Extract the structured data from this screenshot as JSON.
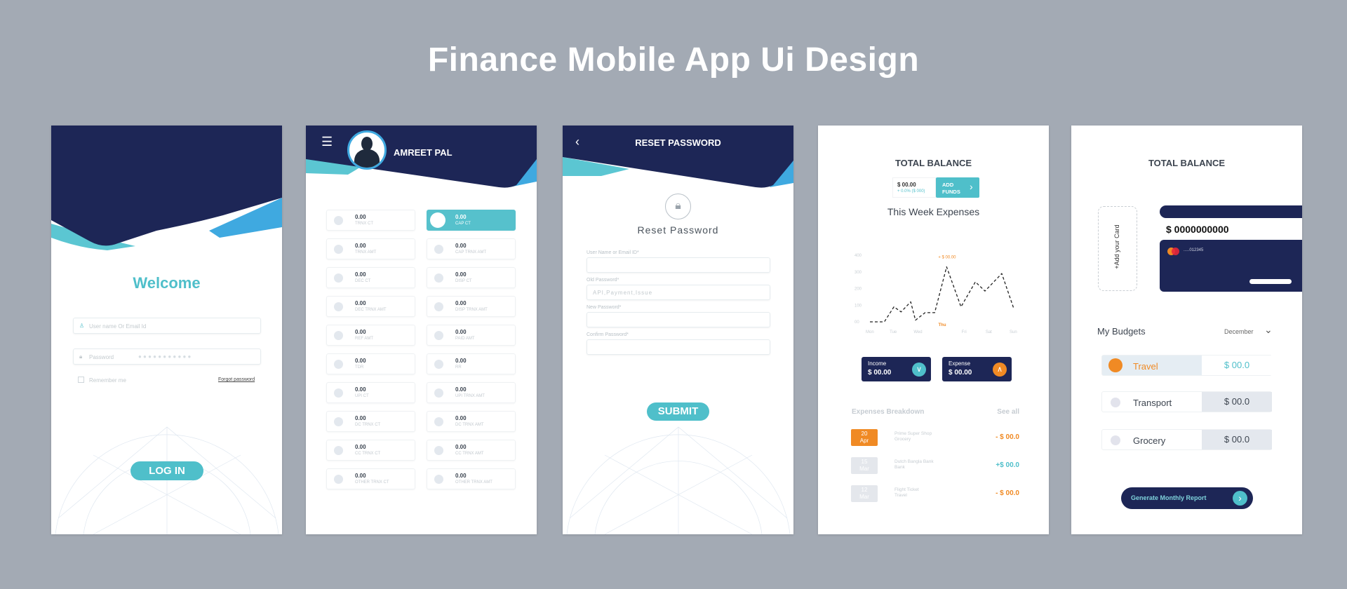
{
  "page_title": "Finance Mobile App Ui Design",
  "colors": {
    "navy": "#1d2656",
    "teal": "#4fbfca",
    "orange": "#f08a24",
    "background": "#a3aab4"
  },
  "login": {
    "welcome": "Welcome",
    "username_placeholder": "User name Or Email Id",
    "password_label": "Password",
    "password_mask": "● ● ● ● ● ● ● ● ● ● ●",
    "remember": "Remember me",
    "forgot": "Forgot password",
    "login_button": "LOG IN"
  },
  "dashboard": {
    "user_name": "AMREET PAL",
    "menu_icon": "hamburger-icon",
    "tiles": [
      {
        "value": "0.00",
        "label": "TRNX CT"
      },
      {
        "value": "0.00",
        "label": "CAP CT",
        "active": true
      },
      {
        "value": "0.00",
        "label": "TRNX AMT"
      },
      {
        "value": "0.00",
        "label": "CAP TRNX AMT"
      },
      {
        "value": "0.00",
        "label": "DEC CT"
      },
      {
        "value": "0.00",
        "label": "DISP CT"
      },
      {
        "value": "0.00",
        "label": "DEC TRNX AMT"
      },
      {
        "value": "0.00",
        "label": "DISP TRNX AMT"
      },
      {
        "value": "0.00",
        "label": "REF AMT"
      },
      {
        "value": "0.00",
        "label": "PAID AMT"
      },
      {
        "value": "0.00",
        "label": "TDR"
      },
      {
        "value": "0.00",
        "label": "RR"
      },
      {
        "value": "0.00",
        "label": "UPI CT"
      },
      {
        "value": "0.00",
        "label": "UPI TRNX AMT"
      },
      {
        "value": "0.00",
        "label": "DC TRNX CT"
      },
      {
        "value": "0.00",
        "label": "DC TRNX AMT"
      },
      {
        "value": "0.00",
        "label": "CC TRNX CT"
      },
      {
        "value": "0.00",
        "label": "CC TRNX AMT"
      },
      {
        "value": "0.00",
        "label": "OTHER TRNX CT"
      },
      {
        "value": "0.00",
        "label": "OTHER TRNX AMT"
      }
    ]
  },
  "reset": {
    "header": "RESET PASSWORD",
    "heading": "Reset Password",
    "fields": [
      {
        "label": "User Name or Email ID*",
        "value": ""
      },
      {
        "label": "Old Password*",
        "value": "API,Payment,Issue"
      },
      {
        "label": "New Password*",
        "value": ""
      },
      {
        "label": "Confirm Password*",
        "value": ""
      }
    ],
    "submit": "SUBMIT"
  },
  "balance": {
    "title": "TOTAL BALANCE",
    "amount": "$ 00.00",
    "change": "+ 0.0% ($ 000)",
    "add_funds_1": "ADD",
    "add_funds_2": "FUNDS",
    "chart_title": "This Week Expenses",
    "income_label": "Income",
    "income_value": "$ 00.00",
    "expense_label": "Expense",
    "expense_value": "$ 00.00",
    "breakdown_title": "Expenses Breakdown",
    "see_all": "See all",
    "transactions": [
      {
        "day": "20",
        "month": "Apr",
        "name": "Prime Super Shop",
        "category": "Grocery",
        "amount": "- $ 00.0",
        "type": "debit",
        "highlight": true
      },
      {
        "day": "15",
        "month": "Mar",
        "name": "Dutch Bangla Bank",
        "category": "Bank",
        "amount": "+$ 00.0",
        "type": "credit"
      },
      {
        "day": "12",
        "month": "Mar",
        "name": "Flight Ticket",
        "category": "Travel",
        "amount": "- $ 00.0",
        "type": "debit"
      }
    ]
  },
  "chart_data": {
    "type": "line",
    "title": "This Week Expenses",
    "x_ticks": [
      "Mon",
      "Tue",
      "Wed",
      "Thu",
      "Fri",
      "Sat",
      "Sun"
    ],
    "highlight_x": "Thu",
    "y_ticks": [
      "00",
      "100",
      "200",
      "300",
      "400"
    ],
    "ylim": [
      0,
      400
    ],
    "annotation": "+ $ 00.00",
    "line_style": "dashed",
    "points": [
      [
        0,
        0
      ],
      [
        0.6,
        0
      ],
      [
        1,
        90
      ],
      [
        1.3,
        60
      ],
      [
        1.7,
        120
      ],
      [
        1.9,
        10
      ],
      [
        2.3,
        55
      ],
      [
        2.7,
        55
      ],
      [
        3.2,
        330
      ],
      [
        3.8,
        90
      ],
      [
        4.4,
        240
      ],
      [
        4.8,
        185
      ],
      [
        5.5,
        290
      ],
      [
        6,
        80
      ]
    ]
  },
  "budgets": {
    "title": "TOTAL BALANCE",
    "add_card": "+Add your Card",
    "card_amount": "$ 0000000000",
    "card_number": ".....012345",
    "section": "My Budgets",
    "month": "December",
    "items": [
      {
        "name": "Travel",
        "value": "$ 00.0",
        "active": true
      },
      {
        "name": "Transport",
        "value": "$ 00.0"
      },
      {
        "name": "Grocery",
        "value": "$ 00.0"
      }
    ],
    "report_button": "Generate Monthly Report"
  }
}
